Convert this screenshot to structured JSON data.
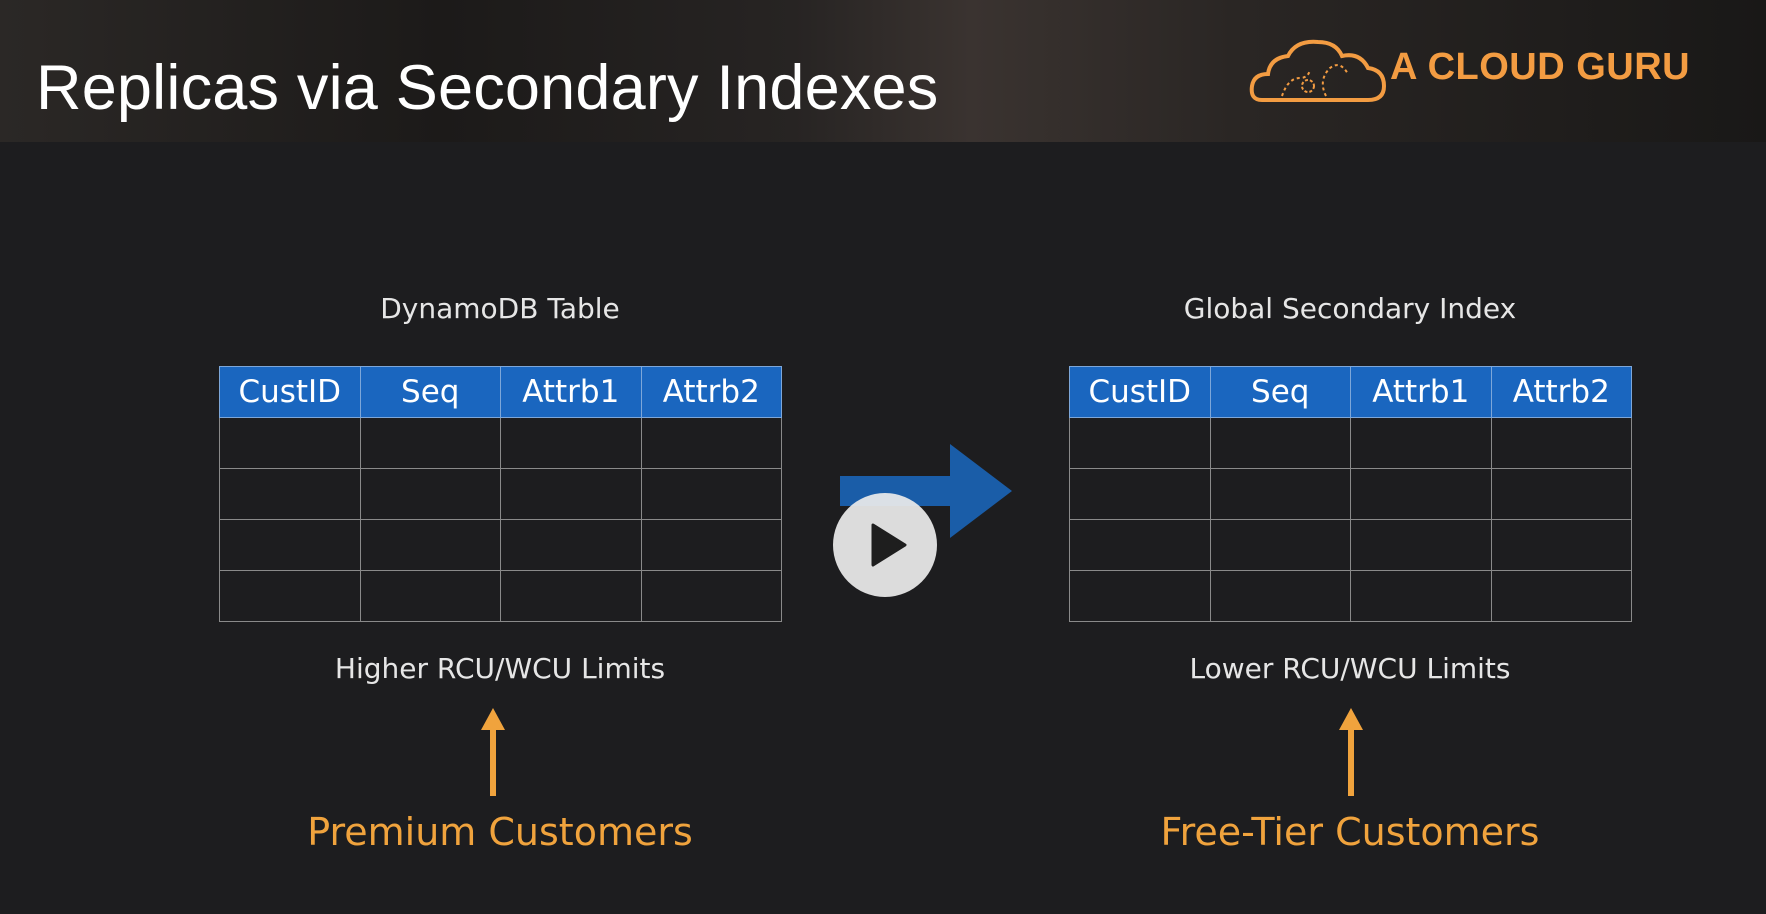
{
  "header": {
    "title": "Replicas via Secondary Indexes",
    "brand": "A CLOUD GURU"
  },
  "left": {
    "caption": "DynamoDB Table",
    "columns": [
      "CustID",
      "Seq",
      "Attrb1",
      "Attrb2"
    ],
    "limits": "Higher RCU/WCU Limits",
    "customers": "Premium Customers"
  },
  "right": {
    "caption": "Global Secondary Index",
    "columns": [
      "CustID",
      "Seq",
      "Attrb1",
      "Attrb2"
    ],
    "limits": "Lower RCU/WCU Limits",
    "customers": "Free-Tier Customers"
  },
  "colors": {
    "header_blue": "#1a66bf",
    "accent_orange": "#f0a33d",
    "arrow_blue": "#1a5da8"
  },
  "icons": {
    "logo": "cloud-logo-icon",
    "arrow": "right-arrow-icon",
    "play": "play-icon"
  }
}
